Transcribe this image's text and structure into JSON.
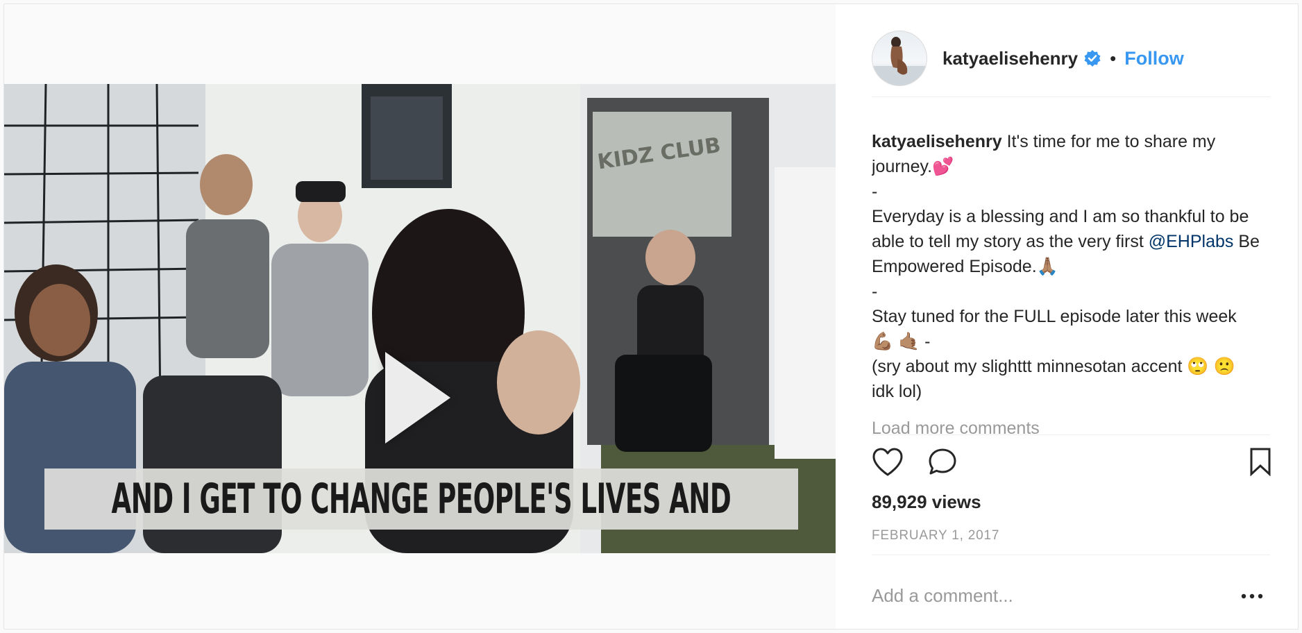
{
  "header": {
    "username": "katyaelisehenry",
    "separator": "•",
    "follow_label": "Follow"
  },
  "video": {
    "caption": "AND I GET TO CHANGE PEOPLE'S LIVES AND",
    "sign_text": "KIDZ CLUB"
  },
  "caption": {
    "username": "katyaelisehenry",
    "line1": " It's time for me to share my journey.💕",
    "line2": "-",
    "line3": "Everyday is a blessing and I am so thankful to be able to tell my story as the very first ",
    "mention": "@EHPlabs",
    "line3b": " Be Empowered Episode.🙏🏽",
    "line4": "-",
    "line5": "Stay tuned for the FULL episode later this week 💪🏽 🤙🏽  -",
    "line6": "(sry about my slighttt minnesotan accent 🙄 🙁  idk lol)"
  },
  "load_more_label": "Load more comments",
  "actions": {
    "like_icon": "heart-icon",
    "comment_icon": "comment-bubble-icon",
    "save_icon": "bookmark-icon"
  },
  "stats": {
    "views": "89,929 views",
    "date": "FEBRUARY 1, 2017"
  },
  "comment_box": {
    "placeholder": "Add a comment...",
    "more_icon": "more-options-icon"
  },
  "colors": {
    "follow_blue": "#3897f0",
    "verified_blue": "#3897f0",
    "mention": "#003569",
    "muted": "#999999"
  }
}
